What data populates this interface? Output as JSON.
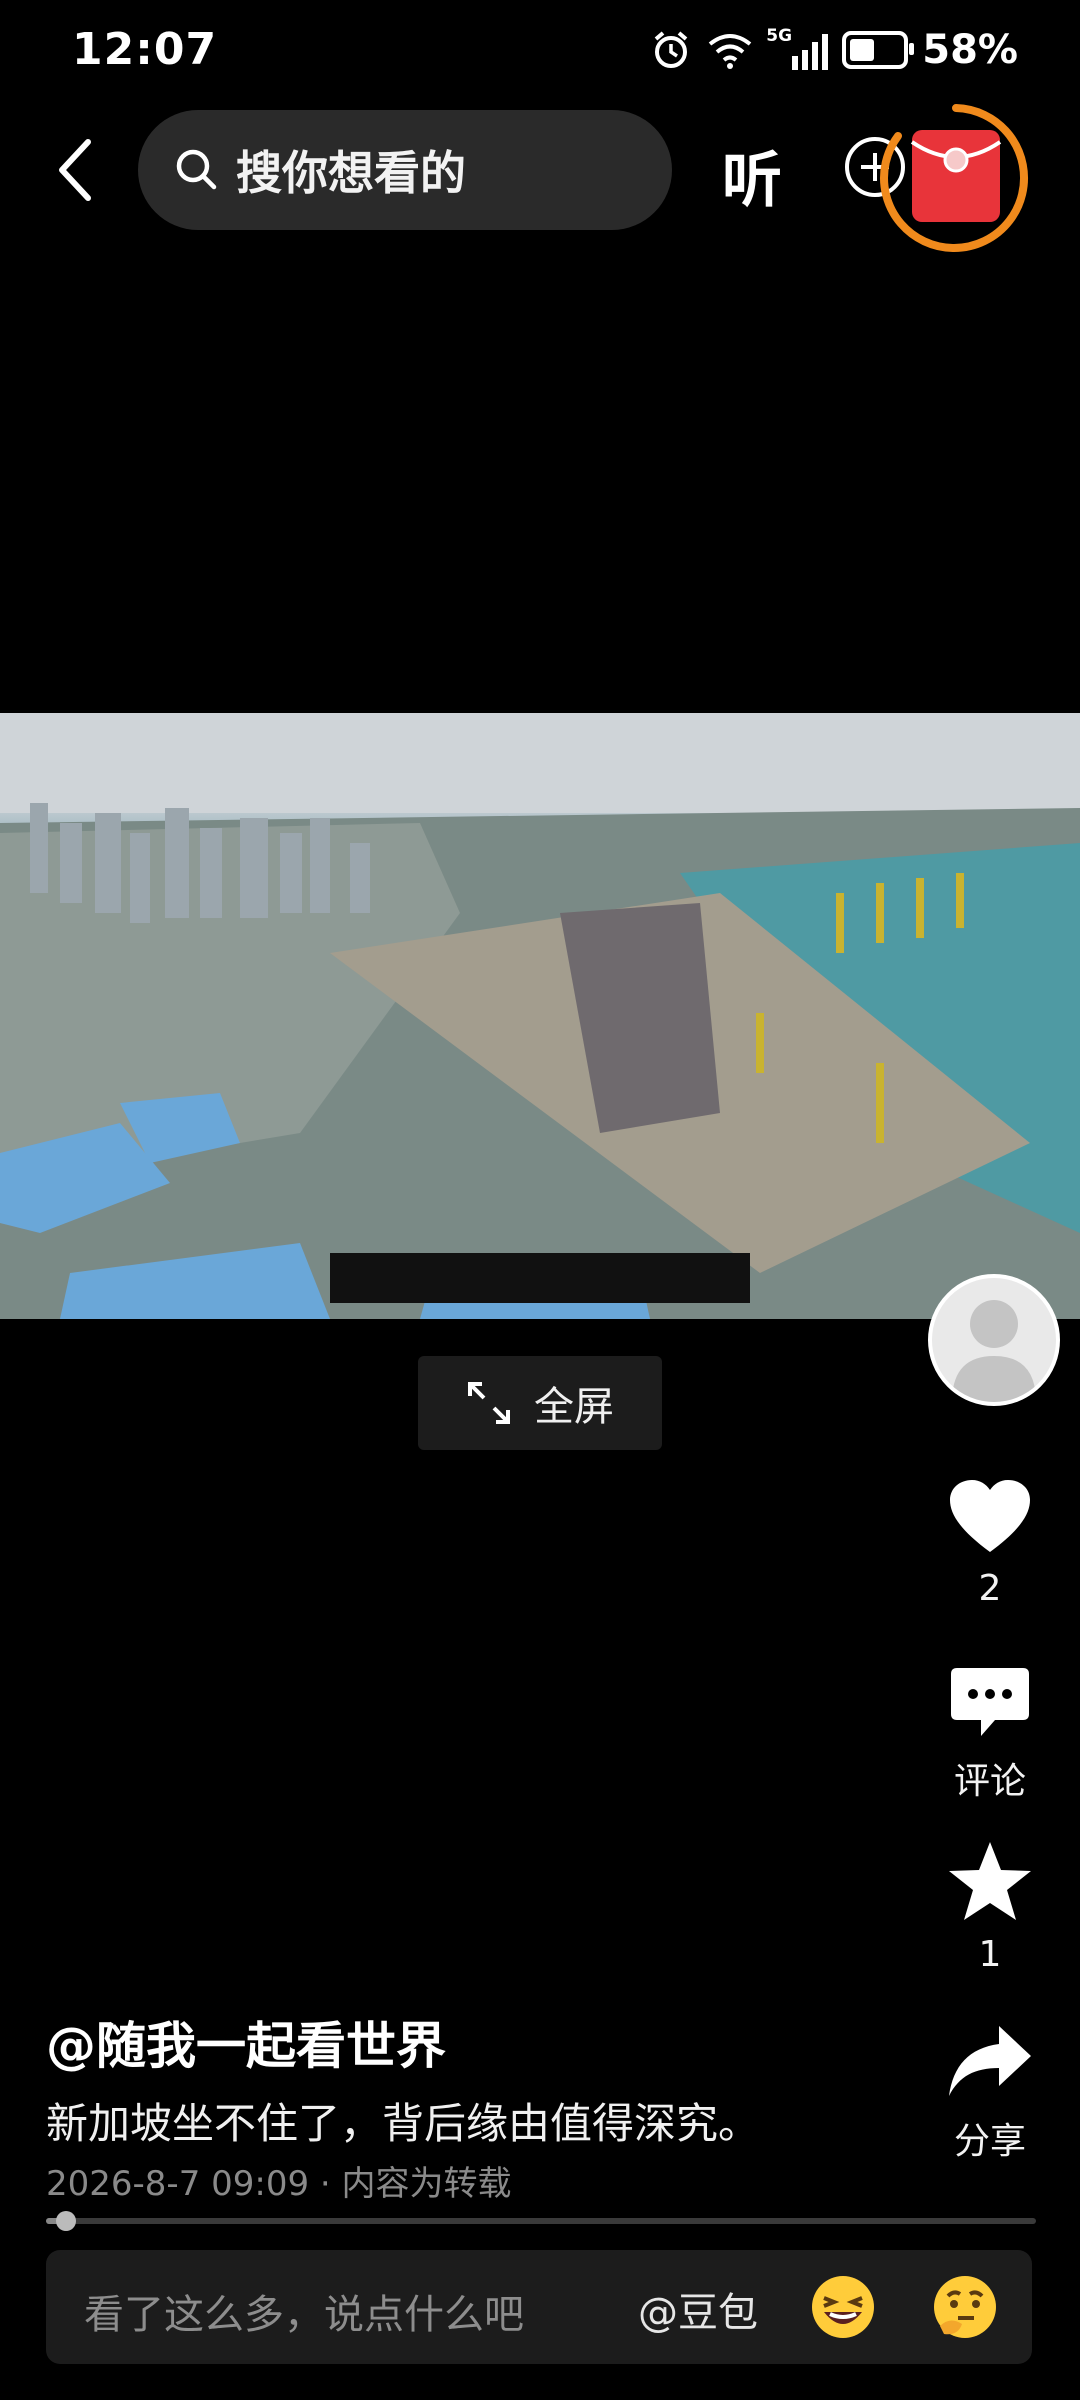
{
  "status": {
    "time": "12:07",
    "network": "5G",
    "battery": "58%"
  },
  "search": {
    "placeholder": "搜你想看的",
    "listen_label": "听"
  },
  "video": {
    "fullscreen_label": "全屏"
  },
  "actions": {
    "like_count": "2",
    "comment_label": "评论",
    "favorite_count": "1",
    "share_label": "分享"
  },
  "post": {
    "author": "@随我一起看世界",
    "caption": "新加坡坐不住了，背后缘由值得深究。",
    "meta": "2026-8-7 09:09 · 内容为转载",
    "progress_fraction": 0.014
  },
  "comment": {
    "placeholder": "看了这么多，说点什么吧",
    "mention": "@豆包"
  },
  "colors": {
    "background": "#000000",
    "redpacket": "#e8343a",
    "ring": "#f08a1c"
  }
}
